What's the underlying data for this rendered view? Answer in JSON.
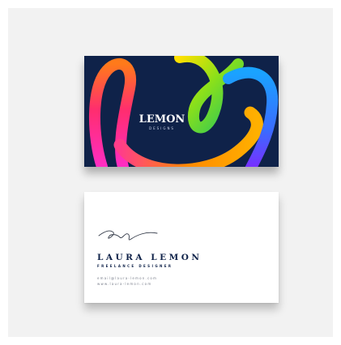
{
  "front": {
    "brand": "LEMON",
    "brand_sub": "DESIGNS",
    "background_color": "#0f2249",
    "ribbon_colors": [
      "#ff2d8a",
      "#ff8a00",
      "#ffd400",
      "#6ad41b",
      "#1aa3ff",
      "#7b2cff"
    ]
  },
  "back": {
    "name": "LAURA LEMON",
    "title": "FREELANCE DESIGNER",
    "email": "email@laura-lemon.com",
    "website": "www.laura-lemon.com"
  }
}
